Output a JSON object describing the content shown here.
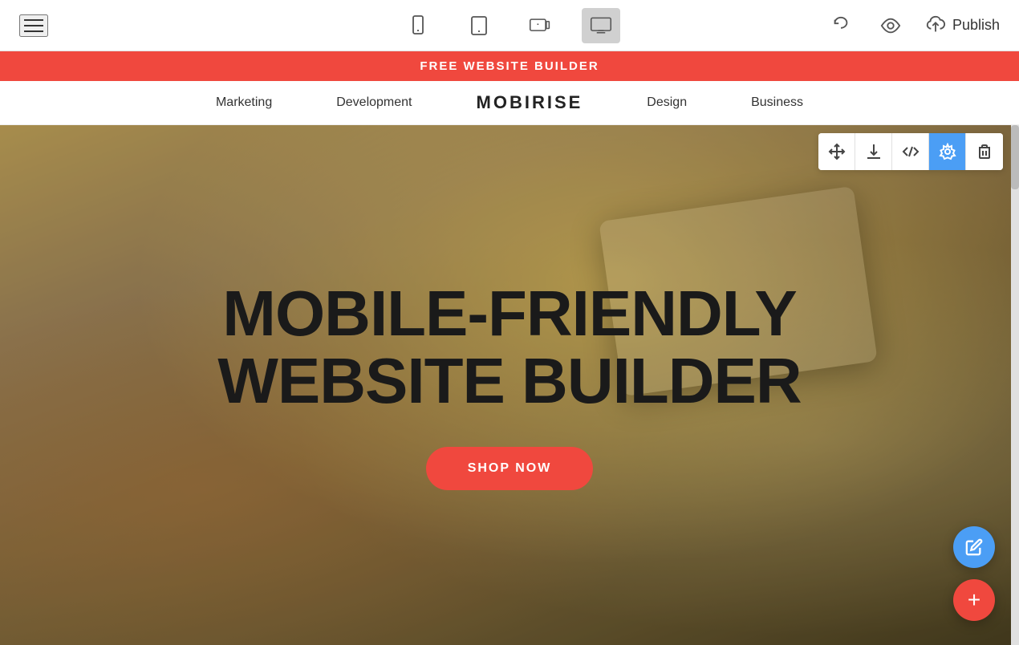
{
  "toolbar": {
    "hamburger_label": "menu",
    "devices": [
      {
        "id": "mobile",
        "label": "Mobile view",
        "active": false
      },
      {
        "id": "tablet",
        "label": "Tablet view",
        "active": false
      },
      {
        "id": "tablet-landscape",
        "label": "Tablet landscape view",
        "active": false
      },
      {
        "id": "desktop",
        "label": "Desktop view",
        "active": true
      }
    ],
    "undo_label": "Undo",
    "preview_label": "Preview",
    "publish_label": "Publish",
    "publish_icon": "cloud-upload-icon"
  },
  "free_banner": {
    "text": "FREE WEBSITE BUILDER"
  },
  "nav": {
    "brand": "MOBIRISE",
    "links": [
      "Marketing",
      "Development",
      "Design",
      "Business"
    ]
  },
  "hero": {
    "title_line1": "MOBILE-FRIENDLY",
    "title_line2": "WEBSITE BUILDER",
    "cta_label": "SHOP NOW"
  },
  "block_toolbar": {
    "buttons": [
      {
        "id": "move",
        "label": "Move block",
        "icon": "arrows-icon",
        "active": false
      },
      {
        "id": "download",
        "label": "Download block",
        "icon": "download-icon",
        "active": false
      },
      {
        "id": "code",
        "label": "Edit code",
        "icon": "code-icon",
        "active": false
      },
      {
        "id": "settings",
        "label": "Block settings",
        "icon": "settings-icon",
        "active": true
      },
      {
        "id": "delete",
        "label": "Delete block",
        "icon": "trash-icon",
        "active": false
      }
    ]
  },
  "fabs": {
    "pencil_label": "Edit",
    "plus_label": "Add block"
  },
  "colors": {
    "accent_red": "#f0483e",
    "accent_blue": "#4b9ef5"
  }
}
